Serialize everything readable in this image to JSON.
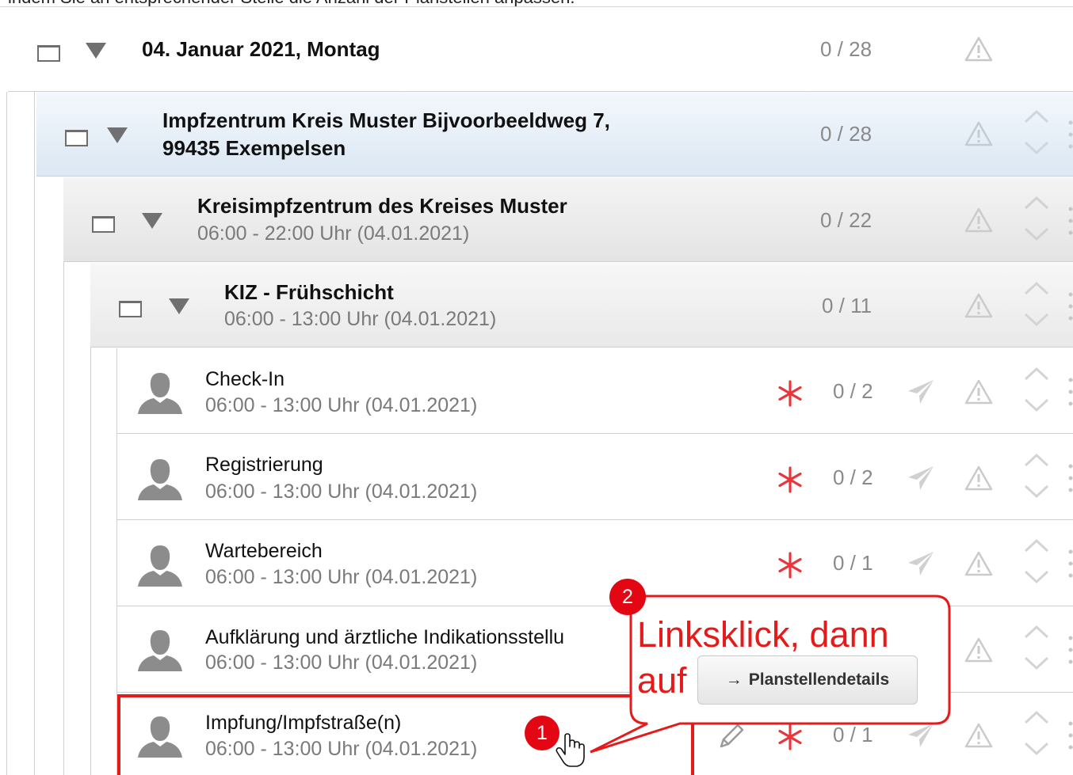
{
  "intro_text": "indem Sie an entsprechender Stelle die Anzahl der Planstellen anpassen.",
  "day": {
    "title": "04. Januar 2021, Montag",
    "count": "0 / 28"
  },
  "center": {
    "title_line1": "Impfzentrum Kreis Muster Bijvoorbeeldweg 7,",
    "title_line2": "99435 Exempelsen",
    "count": "0 / 28"
  },
  "kiz": {
    "title": "Kreisimpfzentrum des Kreises Muster",
    "time": "06:00 - 22:00 Uhr (04.01.2021)",
    "count": "0 / 22"
  },
  "shift": {
    "title": "KIZ - Frühschicht",
    "time": "06:00 - 13:00 Uhr (04.01.2021)",
    "count": "0 / 11"
  },
  "positions": [
    {
      "title": "Check-In",
      "time": "06:00 - 13:00 Uhr (04.01.2021)",
      "count": "0 / 2"
    },
    {
      "title": "Registrierung",
      "time": "06:00 - 13:00 Uhr (04.01.2021)",
      "count": "0 / 2"
    },
    {
      "title": "Wartebereich",
      "time": "06:00 - 13:00 Uhr (04.01.2021)",
      "count": "0 / 1"
    },
    {
      "title": "Aufklärung und ärztliche Indikationsstellu",
      "time": "06:00 - 13:00 Uhr (04.01.2021)",
      "count": ""
    },
    {
      "title": "Impfung/Impfstraße(n)",
      "time": "06:00 - 13:00 Uhr (04.01.2021)",
      "count": "0 / 1"
    }
  ],
  "callout": {
    "line1": "Linksklick, dann",
    "line2": "auf",
    "button_label": "Planstellendetails",
    "button_arrow": "→",
    "step1": "1",
    "step2": "2"
  },
  "colors": {
    "highlight_red": "#e31b1b",
    "required_star": "#e8363c",
    "center_bg": "#dbe7f3"
  },
  "icons": {
    "checkbox": "checkbox-icon",
    "expand": "triangle-down-icon",
    "warning": "warning-icon",
    "reorder": "chevron-up-down-icon",
    "more": "vertical-dots-icon",
    "person": "person-icon",
    "required": "asterisk-icon",
    "send": "paper-plane-icon",
    "edit": "pencil-icon",
    "cursor": "hand-cursor-icon"
  }
}
